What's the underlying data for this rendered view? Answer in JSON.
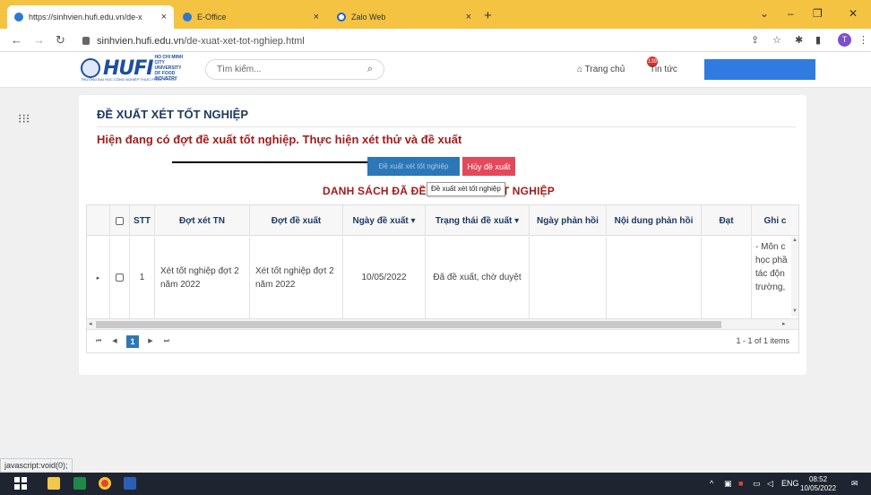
{
  "browser": {
    "tabs": [
      {
        "label": "https://sinhvien.hufi.edu.vn/de-x",
        "active": true
      },
      {
        "label": "E-Office",
        "active": false
      },
      {
        "label": "Zalo Web",
        "active": false
      }
    ],
    "tab_close": "×",
    "new_tab": "+",
    "window_controls": [
      "⌄",
      "–",
      "❐",
      "✕"
    ],
    "url_host": "sinhvien.hufi.edu.vn",
    "url_path": "/de-xuat-xet-tot-nghiep.html"
  },
  "header": {
    "logo_text": "HUFI",
    "logo_sub": "HO CHI MINH CITY UNIVERSITY OF FOOD INDUSTRY",
    "logo_tagline": "TRƯỜNG ĐẠI HỌC CÔNG NGHIỆP THỰC PHẨM TP.HCM",
    "search_placeholder": "Tìm kiếm...",
    "home_label": "Trang chủ",
    "news_label": "Tin tức",
    "news_count": "139"
  },
  "main": {
    "page_title": "ĐỀ XUẤT XÉT TỐT NGHIỆP",
    "notice": "Hiện đang có đợt đề xuất tốt nghiệp. Thực hiện xét thử và đề xuất",
    "btn_propose": "Đề xuất xét tốt nghiệp",
    "btn_cancel": "Hủy đề xuất",
    "tooltip": "Đề xuất xét tốt nghiệp",
    "list_title": "DANH SÁCH ĐÃ ĐỀ XUẤT XÉT TỐT NGHIỆP"
  },
  "table": {
    "columns": [
      "STT",
      "Đợt xét TN",
      "Đợt đề xuất",
      "Ngày đề xuất ▾",
      "Trạng thái đề xuất ▾",
      "Ngày phản hồi",
      "Nội dung phản hồi",
      "Đạt",
      "Ghi c"
    ],
    "rows": [
      {
        "stt": "1",
        "dot_xet": "Xét tốt nghiệp đợt 2 năm 2022",
        "dot_de_xuat": "Xét tốt nghiệp đợt 2 năm 2022",
        "ngay_de_xuat": "10/05/2022",
        "trang_thai": "Đã đề xuất, chờ duyệt",
        "ngay_phan_hoi": "",
        "noi_dung": "",
        "dat": "",
        "ghi_chu": "- Môn c học phầ tác độn trường,"
      }
    ],
    "pager": {
      "first": "⏮",
      "prev": "◀",
      "page": "1",
      "next": "▶",
      "last": "⏭",
      "info": "1 - 1 of 1 items"
    }
  },
  "status_text": "javascript:void(0);",
  "taskbar": {
    "lang": "ENG",
    "time": "08:52",
    "date": "10/05/2022"
  },
  "colors": {
    "tabbar": "#f5c342",
    "primary_button": "#2c77b8",
    "danger_button": "#e3495a",
    "notice_text": "#a31c1c"
  }
}
